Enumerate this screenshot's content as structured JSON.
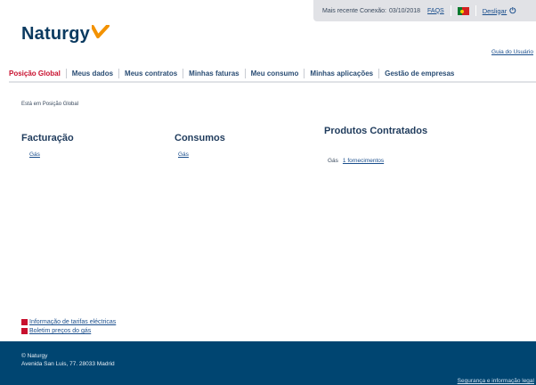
{
  "topbar": {
    "last_connection_label": "Mais recente Conexão:",
    "last_connection_date": "03/10/2018",
    "faqs": "FAQS",
    "logout": "Desligar"
  },
  "brand": {
    "name": "Naturgy"
  },
  "user_guide": "Guia do Usuário",
  "nav": {
    "items": [
      {
        "label": "Posição Global"
      },
      {
        "label": "Meus dados"
      },
      {
        "label": "Meus contratos"
      },
      {
        "label": "Minhas faturas"
      },
      {
        "label": "Meu consumo"
      },
      {
        "label": "Minhas aplicações"
      },
      {
        "label": "Gestão de empresas"
      }
    ],
    "active_index": 0
  },
  "breadcrumb": {
    "prefix": "Está em",
    "current": "Posição Global"
  },
  "billing": {
    "title": "Facturação",
    "link": "Gás"
  },
  "consumption": {
    "title": "Consumos",
    "link": "Gás"
  },
  "products": {
    "title": "Produtos Contratados",
    "type": "Gás",
    "link": "1 fornecimentos"
  },
  "info_links": [
    {
      "label": "Informação de tarifas eléctricas"
    },
    {
      "label": "Boletim preços do gás"
    }
  ],
  "footer": {
    "company": "© Naturgy",
    "address": "Avenida San Luis, 77. 28033 Madrid",
    "legal": "Segurança e informação legal"
  },
  "colors": {
    "brand_navy": "#0b3a60",
    "accent_red": "#c8102e",
    "logo_orange": "#f39200",
    "footer_bg": "#004571",
    "topbar_bg": "#e1e2e6"
  }
}
